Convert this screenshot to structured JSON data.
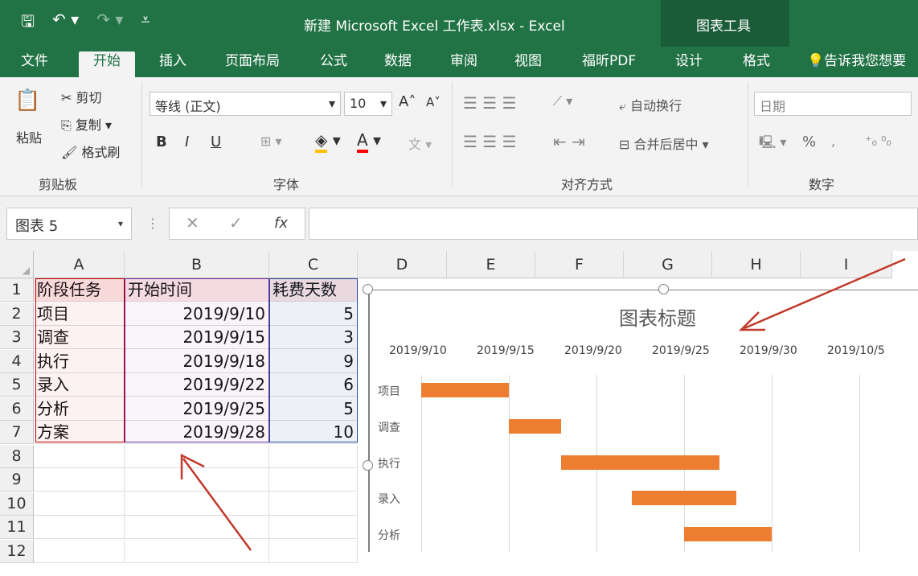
{
  "title_bar": {
    "doc_title": "新建 Microsoft Excel 工作表.xlsx - Excel",
    "chart_tools": "图表工具"
  },
  "tabs": [
    "文件",
    "开始",
    "插入",
    "页面布局",
    "公式",
    "数据",
    "审阅",
    "视图",
    "福昕PDF",
    "设计",
    "格式",
    "告诉我您想要"
  ],
  "ribbon": {
    "clipboard": {
      "paste": "粘贴",
      "cut": "剪切",
      "copy": "复制",
      "format_painter": "格式刷",
      "label": "剪贴板"
    },
    "font": {
      "family": "等线 (正文)",
      "size": "10",
      "label": "字体",
      "bold": "B",
      "italic": "I",
      "underline": "U"
    },
    "alignment": {
      "wrap": "自动换行",
      "merge": "合并后居中",
      "label": "对齐方式"
    },
    "number": {
      "format": "日期",
      "label": "数字",
      "percent": "%"
    }
  },
  "formula_bar": {
    "name_box": "图表 5",
    "fx": "fx"
  },
  "columns": [
    "A",
    "B",
    "C",
    "D",
    "E",
    "F",
    "G",
    "H",
    "I"
  ],
  "rows": [
    "1",
    "2",
    "3",
    "4",
    "5",
    "6",
    "7",
    "8",
    "9",
    "10",
    "11",
    "12"
  ],
  "table": {
    "headers": [
      "阶段任务",
      "开始时间",
      "耗费天数"
    ],
    "rows": [
      [
        "项目",
        "2019/9/10",
        "5"
      ],
      [
        "调查",
        "2019/9/15",
        "3"
      ],
      [
        "执行",
        "2019/9/18",
        "9"
      ],
      [
        "录入",
        "2019/9/22",
        "6"
      ],
      [
        "分析",
        "2019/9/25",
        "5"
      ],
      [
        "方案",
        "2019/9/28",
        "10"
      ]
    ]
  },
  "chart_data": {
    "type": "bar",
    "title": "图表标题",
    "x_ticks": [
      "2019/9/10",
      "2019/9/15",
      "2019/9/20",
      "2019/9/25",
      "2019/9/30",
      "2019/10/5"
    ],
    "categories": [
      "项目",
      "调查",
      "执行",
      "录入",
      "分析"
    ],
    "start": [
      "2019/9/10",
      "2019/9/15",
      "2019/9/18",
      "2019/9/22",
      "2019/9/25"
    ],
    "duration": [
      5,
      3,
      9,
      6,
      5
    ],
    "bar_color": "#ed7d31"
  }
}
